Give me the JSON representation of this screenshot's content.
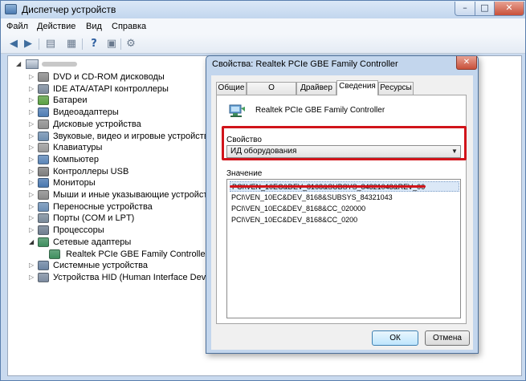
{
  "window": {
    "title": "Диспетчер устройств",
    "controls": {
      "minimize": "–",
      "maximize": "□",
      "close": "✕"
    }
  },
  "menu": [
    "Файл",
    "Действие",
    "Вид",
    "Справка"
  ],
  "toolbar": {
    "icons": [
      "back-icon",
      "forward-icon",
      "properties-icon",
      "scan-icon",
      "help-icon",
      "update-icon",
      "disable-icon"
    ]
  },
  "tree": {
    "items": [
      {
        "label": "DVD и CD-ROM дисководы",
        "icon": "dvd-icon",
        "color": "#8a8a8a"
      },
      {
        "label": "IDE ATA/ATAPI контроллеры",
        "icon": "ide-controller-icon",
        "color": "#7b8a9c"
      },
      {
        "label": "Батареи",
        "icon": "battery-icon",
        "color": "#5aa043"
      },
      {
        "label": "Видеоадаптеры",
        "icon": "display-adapter-icon",
        "color": "#4f7db4"
      },
      {
        "label": "Дисковые устройства",
        "icon": "disk-drive-icon",
        "color": "#8e8e8e"
      },
      {
        "label": "Звуковые, видео и игровые устройства",
        "icon": "sound-icon",
        "color": "#6f8fb0"
      },
      {
        "label": "Клавиатуры",
        "icon": "keyboard-icon",
        "color": "#9a9a9a"
      },
      {
        "label": "Компьютер",
        "icon": "computer-icon",
        "color": "#5c86b8"
      },
      {
        "label": "Контроллеры USB",
        "icon": "usb-icon",
        "color": "#7d7d7d"
      },
      {
        "label": "Мониторы",
        "icon": "monitor-icon",
        "color": "#4a78b0"
      },
      {
        "label": "Мыши и иные указывающие устройства",
        "icon": "mouse-icon",
        "color": "#8a8a8a"
      },
      {
        "label": "Переносные устройства",
        "icon": "portable-device-icon",
        "color": "#6b8eb5"
      },
      {
        "label": "Порты (COM и LPT)",
        "icon": "port-icon",
        "color": "#7a8a9a"
      },
      {
        "label": "Процессоры",
        "icon": "processor-icon",
        "color": "#6e7d8f"
      },
      {
        "label": "Сетевые адаптеры",
        "icon": "network-adapter-icon",
        "color": "#3f8f5f",
        "expanded": true
      },
      {
        "label": "Realtek PCIe GBE Family Controller",
        "icon": "network-card-icon",
        "color": "#3f8f5f",
        "child": true
      },
      {
        "label": "Системные устройства",
        "icon": "system-device-icon",
        "color": "#6d85a3"
      },
      {
        "label": "Устройства HID (Human Interface Devices)",
        "icon": "hid-icon",
        "color": "#7d8ca0"
      }
    ]
  },
  "dialog": {
    "title": "Свойства: Realtek PCIe GBE Family Controller",
    "close": "✕",
    "tabs": [
      "Общие",
      "О программе",
      "Драйвер",
      "Сведения",
      "Ресурсы"
    ],
    "active_tab": "Сведения",
    "device_name": "Realtek PCIe GBE Family Controller",
    "property_label": "Свойство",
    "property_value": "ИД оборудования",
    "value_label": "Значение",
    "values": [
      "PCI\\VEN_10EC&DEV_8168&SUBSYS_84321043&REV_06",
      "PCI\\VEN_10EC&DEV_8168&SUBSYS_84321043",
      "PCI\\VEN_10EC&DEV_8168&CC_020000",
      "PCI\\VEN_10EC&DEV_8168&CC_0200"
    ],
    "ok": "ОК",
    "cancel": "Отмена"
  },
  "annotation_color": "#d1141b"
}
